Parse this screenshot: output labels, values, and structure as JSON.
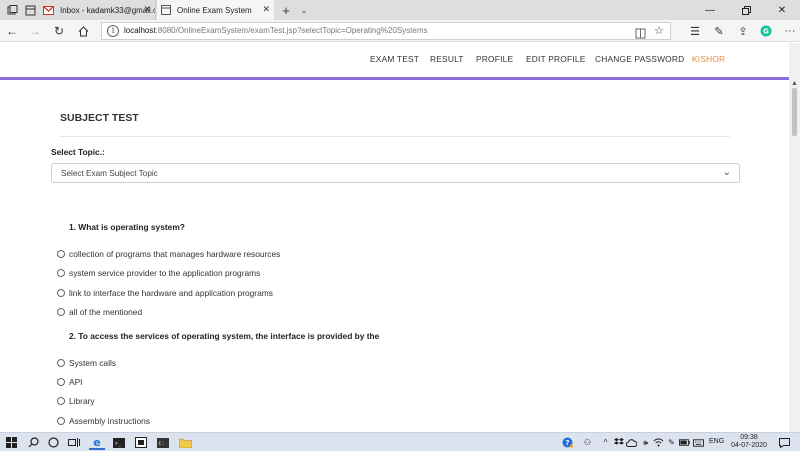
{
  "browser": {
    "tabs": [
      {
        "title": "Inbox - kadamk33@gmail.c",
        "icon": "gmail-icon",
        "active": false
      },
      {
        "title": "Online Exam System",
        "icon": "page-icon",
        "active": true
      }
    ],
    "address": {
      "host": "localhost",
      "rest": ":8080/OnlineExamSystem/examTest.jsp?selectTopic=Operating%20Systems"
    }
  },
  "menu": {
    "exam_test": "EXAM TEST",
    "result": "RESULT",
    "profile": "PROFILE",
    "edit_profile": "EDIT PROFILE",
    "change_password": "CHANGE PASSWORD",
    "user": "KISHOR"
  },
  "page": {
    "title": "SUBJECT TEST",
    "select_label": "Select Topic.:",
    "select_value": "Select Exam Subject Topic"
  },
  "questions": [
    {
      "text": "1. What is operating system?",
      "options": [
        "collection of programs that manages hardware resources",
        "system service provider to the application programs",
        "link to interface the hardware and application programs",
        "all of the mentioned"
      ]
    },
    {
      "text": "2. To access the services of operating system, the interface is provided by the",
      "options": [
        "System calls",
        "API",
        "Library",
        "Assembly instructions"
      ]
    }
  ],
  "taskbar": {
    "language": "ENG",
    "time": "09:38",
    "date": "04-07-2020"
  },
  "colors": {
    "accent_line": "#8b6fd6",
    "user_link": "#e98b39",
    "taskbar": "#dce3ee"
  }
}
